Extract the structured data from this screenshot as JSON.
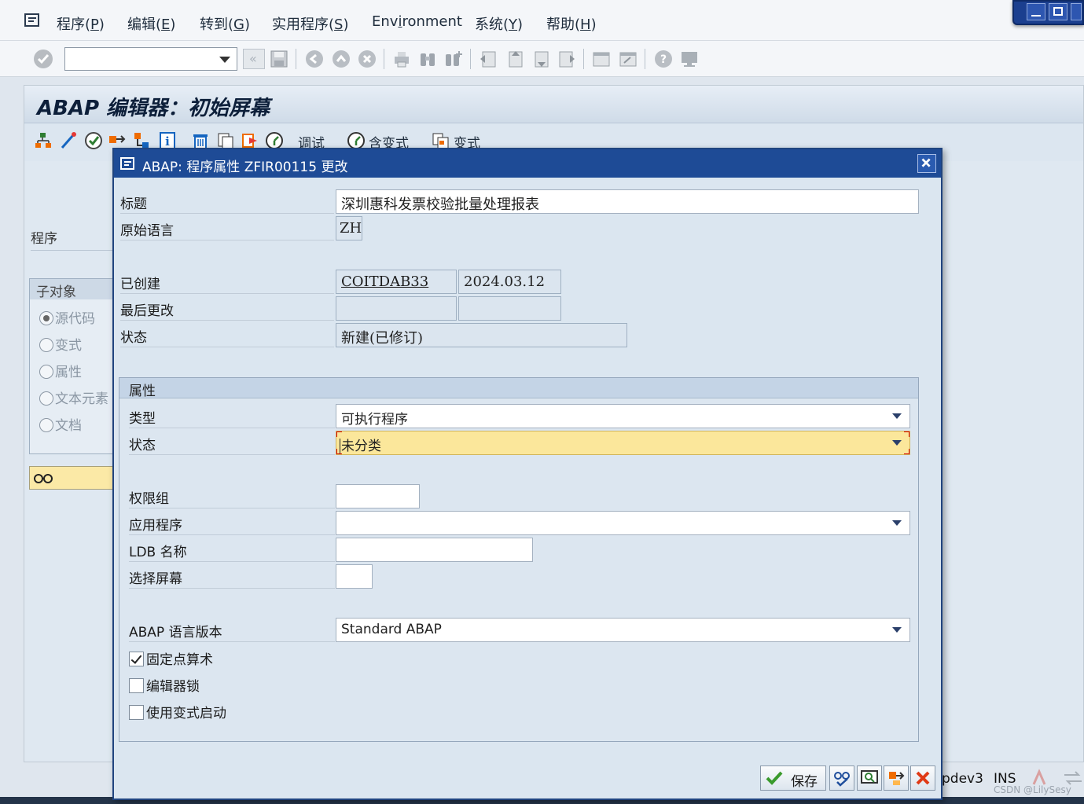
{
  "menu": {
    "items": [
      {
        "text": "程序(",
        "key": "P",
        "tail": ")"
      },
      {
        "text": "编辑(",
        "key": "E",
        "tail": ")"
      },
      {
        "text": "转到(",
        "key": "G",
        "tail": ")"
      },
      {
        "text": "实用程序(",
        "key": "S",
        "tail": ")"
      },
      {
        "text": "Env",
        "key": "i",
        "tail": "ronment"
      },
      {
        "text": "系统(",
        "key": "Y",
        "tail": ")"
      },
      {
        "text": "帮助(",
        "key": "H",
        "tail": ")"
      }
    ]
  },
  "toolbar": {
    "command_field_value": "",
    "icons": [
      "enter-check-icon",
      "back-icon",
      "save-icon",
      "back-nav-icon",
      "exit-icon",
      "cancel-icon",
      "print-icon",
      "find-icon",
      "find-next-icon",
      "first-page-icon",
      "prev-page-icon",
      "next-page-icon",
      "last-page-icon",
      "new-session-icon",
      "shortcut-icon",
      "help-icon",
      "layout-icon"
    ]
  },
  "screen": {
    "title": "ABAP 编辑器：初始屏幕",
    "app_toolbar": {
      "debug_label": "调试",
      "with_variant_label": "含变式",
      "variants_label": "变式"
    },
    "program_label": "程序",
    "subobjects": {
      "title": "子对象",
      "options": [
        {
          "label": "源代码",
          "selected": true
        },
        {
          "label": "变式",
          "selected": false
        },
        {
          "label": "属性",
          "selected": false
        },
        {
          "label": "文本元素",
          "selected": false
        },
        {
          "label": "文档",
          "selected": false
        }
      ]
    }
  },
  "dialog": {
    "title": "ABAP: 程序属性 ZFIR00115 更改",
    "fields": {
      "title_label": "标题",
      "title_value": "深圳惠科发票校验批量处理报表",
      "orig_lang_label": "原始语言",
      "orig_lang_value": "ZH",
      "created_label": "已创建",
      "created_by": "COITDAB33",
      "created_date": "2024.03.12",
      "last_changed_label": "最后更改",
      "last_changed_by": "",
      "last_changed_date": "",
      "status_label": "状态",
      "status_value": "新建(已修订)"
    },
    "attributes": {
      "title": "属性",
      "type_label": "类型",
      "type_value": "可执行程序",
      "status_label": "状态",
      "status_value": "未分类",
      "auth_group_label": "权限组",
      "auth_group_value": "",
      "application_label": "应用程序",
      "application_value": "",
      "ldb_label": "LDB 名称",
      "ldb_value": "",
      "selection_screen_label": "选择屏幕",
      "selection_screen_value": "",
      "abap_version_label": "ABAP 语言版本",
      "abap_version_value": "Standard ABAP",
      "fixed_point_label": "固定点算术",
      "fixed_point_checked": true,
      "editor_lock_label": "编辑器锁",
      "editor_lock_checked": false,
      "start_variant_label": "使用变式启动",
      "start_variant_checked": false
    },
    "footer": {
      "save_label": "保存"
    }
  },
  "statusbar": {
    "server": "pdev3",
    "mode": "INS",
    "watermark": "CSDN @LilySesy"
  },
  "colors": {
    "dialog_title_bg": "#1e4b96",
    "focus_field_bg": "#fbe79b",
    "focus_corner": "#d40000"
  }
}
